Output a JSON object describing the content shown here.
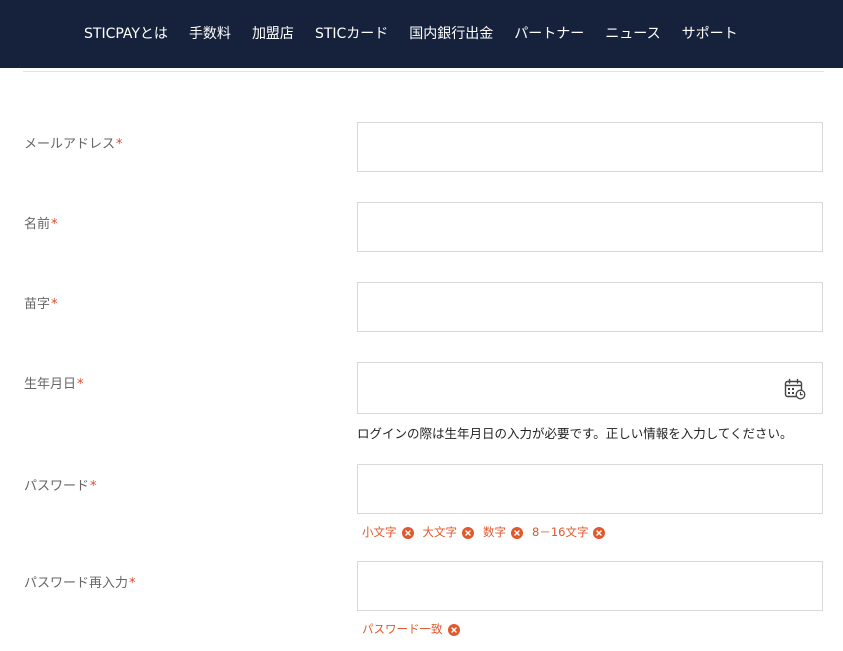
{
  "nav": {
    "items": [
      "STICPAYとは",
      "手数料",
      "加盟店",
      "STICカード",
      "国内銀行出金",
      "パートナー",
      "ニュース",
      "サポート"
    ]
  },
  "form": {
    "required_mark": "*",
    "email": {
      "label": "メールアドレス",
      "value": "",
      "placeholder": ""
    },
    "first_name": {
      "label": "名前",
      "value": "",
      "placeholder": ""
    },
    "last_name": {
      "label": "苗字",
      "value": "",
      "placeholder": ""
    },
    "birthdate": {
      "label": "生年月日",
      "value": "",
      "placeholder": "",
      "icon": "calendar-icon",
      "help": "ログインの際は生年月日の入力が必要です。正しい情報を入力してください。"
    },
    "password": {
      "label": "パスワード",
      "value": "",
      "placeholder": "",
      "rules": [
        "小文字",
        "大文字",
        "数字",
        "8－16文字"
      ]
    },
    "password_confirm": {
      "label": "パスワード再入力",
      "value": "",
      "placeholder": "",
      "rules": [
        "パスワード一致"
      ]
    }
  },
  "colors": {
    "nav_bg": "#16223c",
    "required": "#e0492a",
    "rule_fail": "#e0582c",
    "border": "#d9d9d9"
  }
}
